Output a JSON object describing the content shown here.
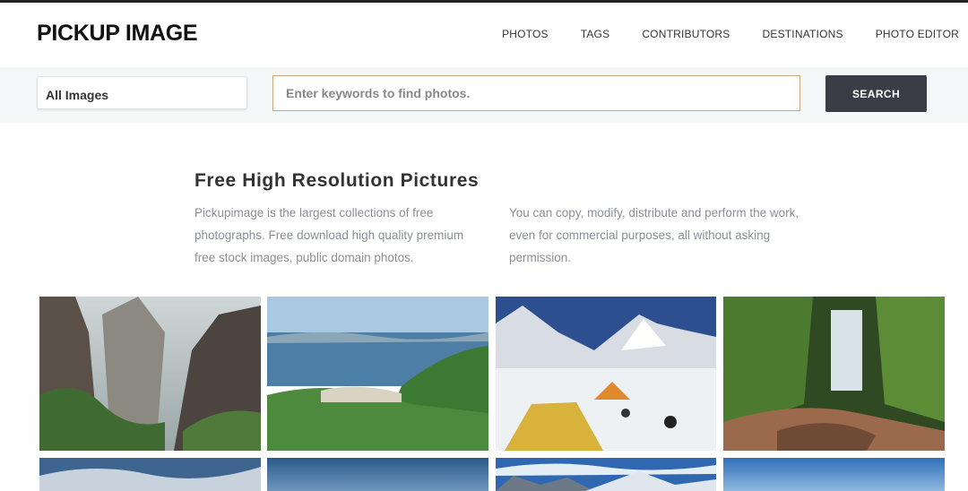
{
  "header": {
    "logo": "PICKUP IMAGE",
    "nav": [
      "PHOTOS",
      "TAGS",
      "CONTRIBUTORS",
      "DESTINATIONS",
      "PHOTO EDITOR"
    ]
  },
  "search": {
    "category": "All Images",
    "placeholder": "Enter keywords to find photos.",
    "button": "SEARCH"
  },
  "intro": {
    "title": "Free High Resolution Pictures",
    "col1": "Pickupimage is the largest collections of free photographs. Free download high quality premium free stock images, public domain photos.",
    "col2": "You can copy, modify, distribute and perform the work, even for commercial purposes, all without asking permission."
  },
  "gallery": [
    {
      "subject": "misty mountain cliffs"
    },
    {
      "subject": "coastal bay with islands"
    },
    {
      "subject": "snowy mountain camp with tents"
    },
    {
      "subject": "forest waterfall"
    },
    {
      "subject": "cloudy sky"
    },
    {
      "subject": "blue sky"
    },
    {
      "subject": "snowy peaks under clouds"
    },
    {
      "subject": "clear blue sky"
    }
  ]
}
